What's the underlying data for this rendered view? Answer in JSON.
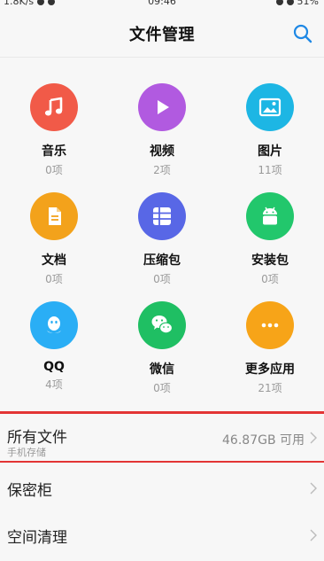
{
  "status_bar": {
    "speed": "1.8K/s",
    "time": "09:46",
    "battery": "51%"
  },
  "header": {
    "title": "文件管理"
  },
  "categories": [
    {
      "label": "音乐",
      "count": "0项",
      "icon": "music-note-icon",
      "color": "#f15a48"
    },
    {
      "label": "视频",
      "count": "2项",
      "icon": "play-icon",
      "color": "#b15ae0"
    },
    {
      "label": "图片",
      "count": "11项",
      "icon": "image-icon",
      "color": "#1db6e4"
    },
    {
      "label": "文档",
      "count": "0项",
      "icon": "document-icon",
      "color": "#f3a21b"
    },
    {
      "label": "压缩包",
      "count": "0项",
      "icon": "archive-icon",
      "color": "#5867e6"
    },
    {
      "label": "安装包",
      "count": "0项",
      "icon": "android-icon",
      "color": "#22c76c"
    },
    {
      "label": "QQ",
      "count": "4项",
      "icon": "qq-icon",
      "color": "#2aaef5"
    },
    {
      "label": "微信",
      "count": "0项",
      "icon": "wechat-icon",
      "color": "#1fbf63"
    },
    {
      "label": "更多应用",
      "count": "21项",
      "icon": "more-apps-icon",
      "color": "#f7a418"
    }
  ],
  "all_files": {
    "title": "所有文件",
    "subtitle": "手机存储",
    "storage": "46.87GB 可用"
  },
  "menu": {
    "safe": "保密柜",
    "cleanup": "空间清理"
  },
  "colors": {
    "highlight": "#e33535",
    "accent": "#1e88e5"
  }
}
